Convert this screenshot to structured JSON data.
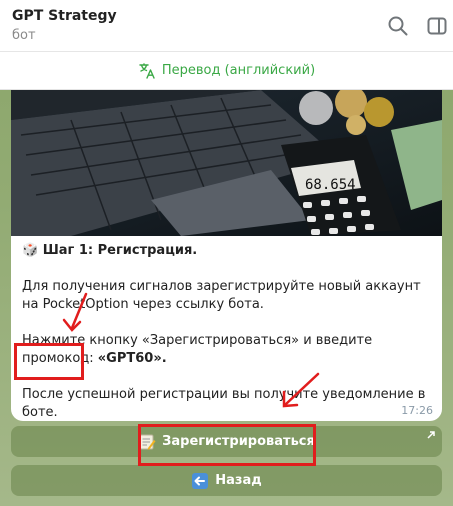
{
  "header": {
    "title": "GPT Strategy",
    "subtitle": "бот"
  },
  "translation": {
    "label": "Перевод (английский)"
  },
  "message": {
    "step_title": "🎲 Шаг 1: Регистрация.",
    "para1": "Для получения сигналов зарегистрируйте новый аккаунт на PocketOption через ссылку бота.",
    "para2_prefix": "Нажмите кнопку «Зарегистрироваться» и введите промокод:",
    "promo": "«GPT60».",
    "para3": "После успешной регистрации вы получите уведомление в боте.",
    "time": "17:26",
    "calculator_display": "68.654"
  },
  "buttons": {
    "register": "Зарегистрироваться",
    "back": "Назад"
  },
  "colors": {
    "accent_green": "#3aa845",
    "highlight_red": "#e11d1d"
  }
}
